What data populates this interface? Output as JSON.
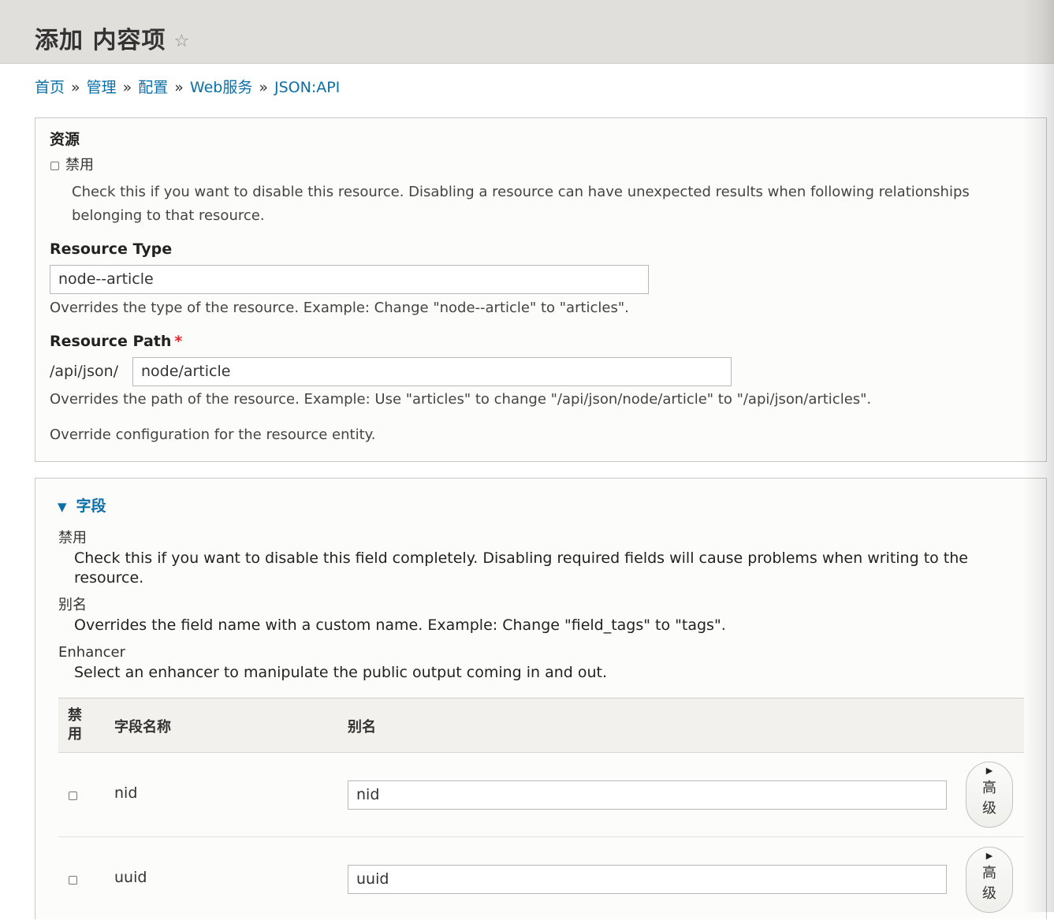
{
  "header": {
    "title": "添加 内容项",
    "star_icon": "star-outline-icon"
  },
  "breadcrumb": {
    "items": [
      "首页",
      "管理",
      "配置",
      "Web服务",
      "JSON:API"
    ],
    "separator": "»"
  },
  "resource_panel": {
    "heading": "资源",
    "disable_label": "禁用",
    "disable_desc_line1": "Check this if you want to disable this resource. Disabling a resource can have unexpected results when following relationships",
    "disable_desc_line2": "belonging to that resource.",
    "type_label": "Resource Type",
    "type_value": "node--article",
    "type_desc": "Overrides the type of the resource. Example: Change \"node--article\" to \"articles\".",
    "path_label": "Resource Path",
    "path_required": "*",
    "path_prefix": "/api/json/",
    "path_value": "node/article",
    "path_desc": "Overrides the path of the resource. Example: Use \"articles\" to change \"/api/json/node/article\" to \"/api/json/articles\".",
    "override_note": "Override configuration for the resource entity."
  },
  "fields_panel": {
    "summary": "字段",
    "disable_term": "禁用",
    "disable_desc_line1": "Check this if you want to disable this field completely. Disabling required fields will cause problems when writing to the",
    "disable_desc_line2": "resource.",
    "alias_term": "别名",
    "alias_desc": "Overrides the field name with a custom name. Example: Change \"field_tags\" to \"tags\".",
    "enhancer_term": "Enhancer",
    "enhancer_desc": "Select an enhancer to manipulate the public output coming in and out.",
    "table": {
      "col_disable_1": "禁",
      "col_disable_2": "用",
      "col_name": "字段名称",
      "col_alias": "别名",
      "rows": [
        {
          "name": "nid",
          "alias": "nid",
          "adv_1": "高",
          "adv_2": "级"
        },
        {
          "name": "uuid",
          "alias": "uuid",
          "adv_1": "高",
          "adv_2": "级"
        }
      ]
    }
  },
  "colors": {
    "link": "#0b6fa8",
    "header_bg": "#e0dfdc",
    "required": "#e0262a"
  }
}
